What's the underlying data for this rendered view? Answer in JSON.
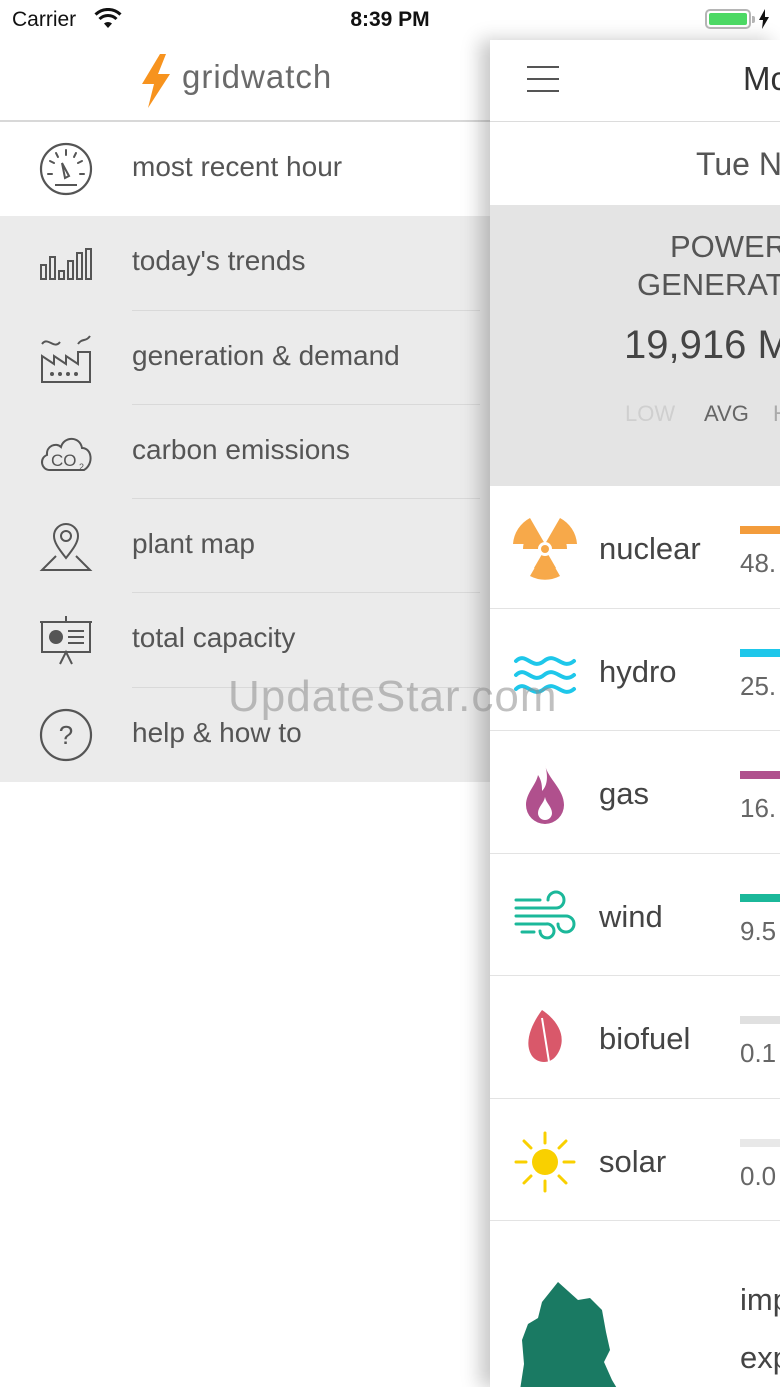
{
  "status_bar": {
    "carrier": "Carrier",
    "time": "8:39 PM"
  },
  "drawer": {
    "brand": "gridwatch",
    "items": [
      {
        "label": "most recent hour",
        "icon": "speedometer-icon",
        "active": true
      },
      {
        "label": "today's trends",
        "icon": "bar-chart-icon"
      },
      {
        "label": "generation & demand",
        "icon": "factory-icon"
      },
      {
        "label": "carbon emissions",
        "icon": "co2-cloud-icon"
      },
      {
        "label": "plant map",
        "icon": "map-pin-icon"
      },
      {
        "label": "total capacity",
        "icon": "presentation-icon"
      },
      {
        "label": "help & how to",
        "icon": "question-icon"
      }
    ]
  },
  "panel": {
    "title": "Mc",
    "date": "Tue N",
    "summary": {
      "line1": "POWER",
      "line2": "GENERAT",
      "total": "19,916 M",
      "low": "LOW",
      "avg": "AVG",
      "high": "H"
    },
    "sources": [
      {
        "name": "nuclear",
        "pct": "48.",
        "color": "#f39c3c",
        "icon": "radiation-icon",
        "level": 1.0
      },
      {
        "name": "hydro",
        "pct": "25.",
        "color": "#1ec7ea",
        "icon": "waves-icon",
        "level": 1.0
      },
      {
        "name": "gas",
        "pct": "16.",
        "color": "#b0508d",
        "icon": "flame-icon",
        "level": 1.0
      },
      {
        "name": "wind",
        "pct": "9.5",
        "color": "#1bb89a",
        "icon": "wind-icon",
        "level": 1.0
      },
      {
        "name": "biofuel",
        "pct": "0.1",
        "color": "#e0e0e0",
        "icon": "leaf-icon",
        "level": 0.05
      },
      {
        "name": "solar",
        "pct": "0.0",
        "color": "#e8e8e8",
        "icon": "sun-icon",
        "level": 0.0
      }
    ],
    "imports_label": "imp",
    "exports_label": "exp"
  },
  "watermark": "UpdateStar.com"
}
